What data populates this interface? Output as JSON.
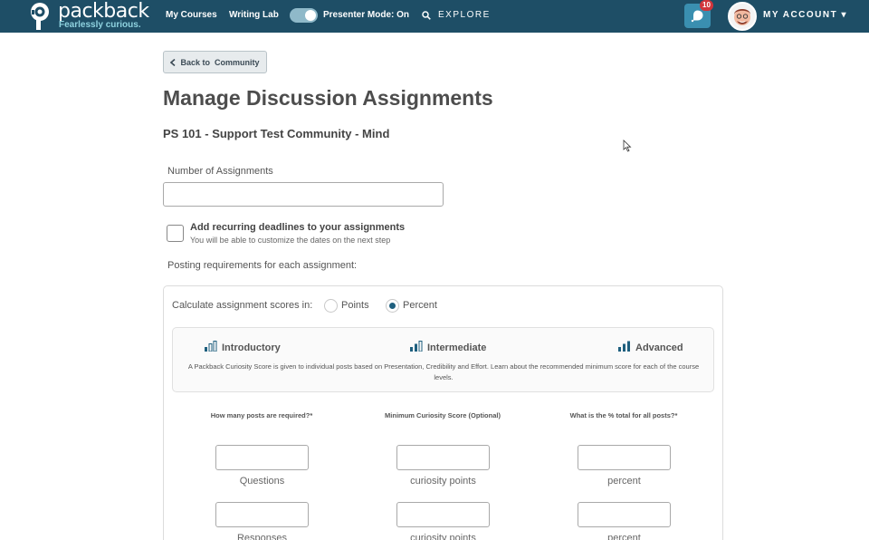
{
  "nav": {
    "brand": "packback",
    "tagline": "Fearlessly curious.",
    "my_courses": "My Courses",
    "writing_lab": "Writing Lab",
    "presenter_mode": "Presenter Mode: On",
    "explore": "EXPLORE",
    "notification_count": "10",
    "my_account": "MY ACCOUNT ▾",
    "accent": "#1e4e66"
  },
  "back_button": {
    "label": "Back to  Community"
  },
  "page_title": "Manage Discussion Assignments",
  "community_name": "PS 101 - Support Test Community - Mind",
  "form": {
    "num_assignments_label": "Number of Assignments",
    "num_assignments_value": "",
    "recurring_title": "Add recurring deadlines to your assignments",
    "recurring_subtitle": "You will be able to customize the dates on the next step",
    "posting_requirements_label": "Posting requirements for each assignment:"
  },
  "scoring": {
    "calc_label": "Calculate assignment scores in:",
    "options": [
      {
        "label": "Points",
        "selected": false
      },
      {
        "label": "Percent",
        "selected": true
      }
    ]
  },
  "levels": {
    "items": [
      "Introductory",
      "Intermediate",
      "Advanced"
    ],
    "description": "A Packback Curiosity Score is given to individual posts based on Presentation, Credibility and Effort. Learn about the recommended minimum score for each of the course levels."
  },
  "requirements": {
    "headers": [
      "How many posts are required?*",
      "Minimum Curiosity Score (Optional)",
      "What is the % total for all posts?*"
    ],
    "rows": [
      {
        "units": [
          "Questions",
          "curiosity points",
          "percent"
        ]
      },
      {
        "units": [
          "Responses",
          "curiosity points",
          "percent"
        ]
      }
    ]
  }
}
